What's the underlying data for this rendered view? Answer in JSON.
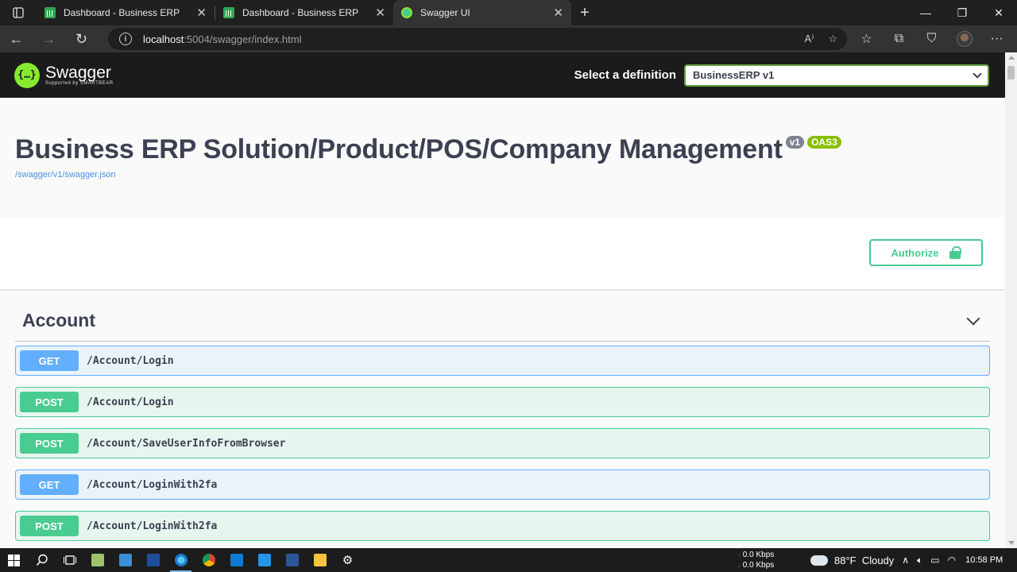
{
  "browser": {
    "tabs": [
      {
        "title": "Dashboard - Business ERP",
        "icon": "chart-favicon",
        "active": false
      },
      {
        "title": "Dashboard - Business ERP",
        "icon": "chart-favicon",
        "active": false
      },
      {
        "title": "Swagger UI",
        "icon": "swagger-favicon",
        "active": true
      }
    ],
    "url_host": "localhost",
    "url_rest": ":5004/swagger/index.html"
  },
  "swagger": {
    "logo_name": "Swagger",
    "logo_sub": "Supported by SMARTBEAR",
    "definition_label": "Select a definition",
    "definition_value": "BusinessERP v1",
    "api_title": "Business ERP Solution/Product/POS/Company Management",
    "version_badge": "v1",
    "oas_badge": "OAS3",
    "spec_link": "/swagger/v1/swagger.json",
    "authorize_label": "Authorize",
    "tag_name": "Account",
    "operations": [
      {
        "method": "GET",
        "path": "/Account/Login"
      },
      {
        "method": "POST",
        "path": "/Account/Login"
      },
      {
        "method": "POST",
        "path": "/Account/SaveUserInfoFromBrowser"
      },
      {
        "method": "GET",
        "path": "/Account/LoginWith2fa"
      },
      {
        "method": "POST",
        "path": "/Account/LoginWith2fa"
      }
    ],
    "colors": {
      "get": "#61affe",
      "post": "#49cc90",
      "title": "#3b4151",
      "topbar": "#1b1b1b"
    }
  },
  "taskbar": {
    "net_up": "0.0 Kbps",
    "net_down": "0.0 Kbps",
    "weather": "88°F  Cloudy",
    "time": "10:58 PM"
  }
}
